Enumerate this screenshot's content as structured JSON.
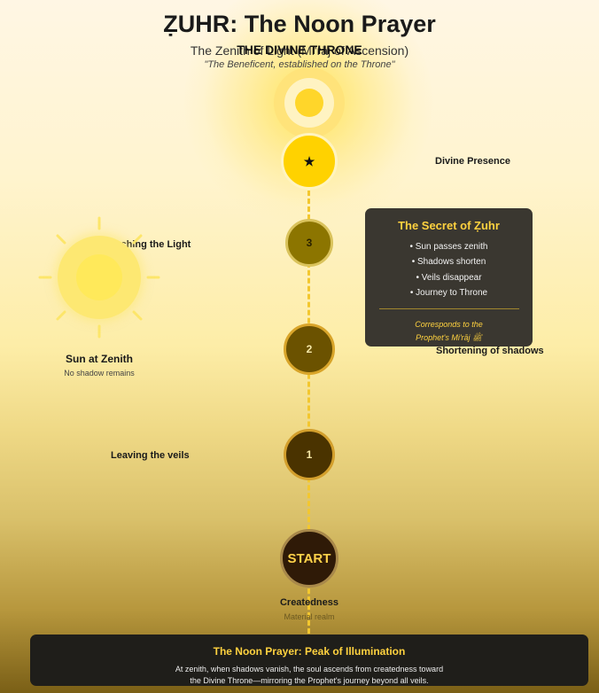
{
  "header": {
    "title": "ẒUHR: The Noon Prayer",
    "subtitle": "The Zenith of Light (Mi'rāj of Ascension)",
    "throne_label": "THE DIVINE THRONE",
    "quote": "\"The Beneficent, established on the Throne\""
  },
  "nodes": [
    {
      "id": "throne",
      "label": "★",
      "caption": "Divine Presence"
    },
    {
      "id": "stage-3",
      "label": "3",
      "caption": "Approaching the Light"
    },
    {
      "id": "stage-2",
      "label": "2",
      "caption": "Shortening of shadows"
    },
    {
      "id": "stage-1",
      "label": "1",
      "caption": "Leaving the veils"
    },
    {
      "id": "start",
      "label": "START",
      "caption": "Createdness",
      "sub": "Material realm"
    }
  ],
  "sun": {
    "title": "Sun at Zenith",
    "subtitle": "No shadow remains"
  },
  "secret_panel": {
    "title": "The Secret of Ẓuhr",
    "items": [
      "• Sun passes zenith",
      "• Shadows shorten",
      "• Veils disappear",
      "• Journey to Throne"
    ],
    "note_line1": "Corresponds to the",
    "note_line2": "Prophet's Mi'rāj ﷺ"
  },
  "footer": {
    "title": "The Noon Prayer: Peak of Illumination",
    "line1": "At zenith, when shadows vanish, the soul ascends from createdness toward",
    "line2": "the Divine Throne—mirroring the Prophet's journey beyond all veils."
  },
  "colors": {
    "gold": "#ffd23f",
    "throne_node": "#ffd200",
    "start_node": "#2f1a07",
    "panel_bg": "#3a3730",
    "footer_bg": "#1f1e1a"
  },
  "icons": {
    "throne_marker": "star-icon",
    "zenith_sun": "sun-icon"
  }
}
